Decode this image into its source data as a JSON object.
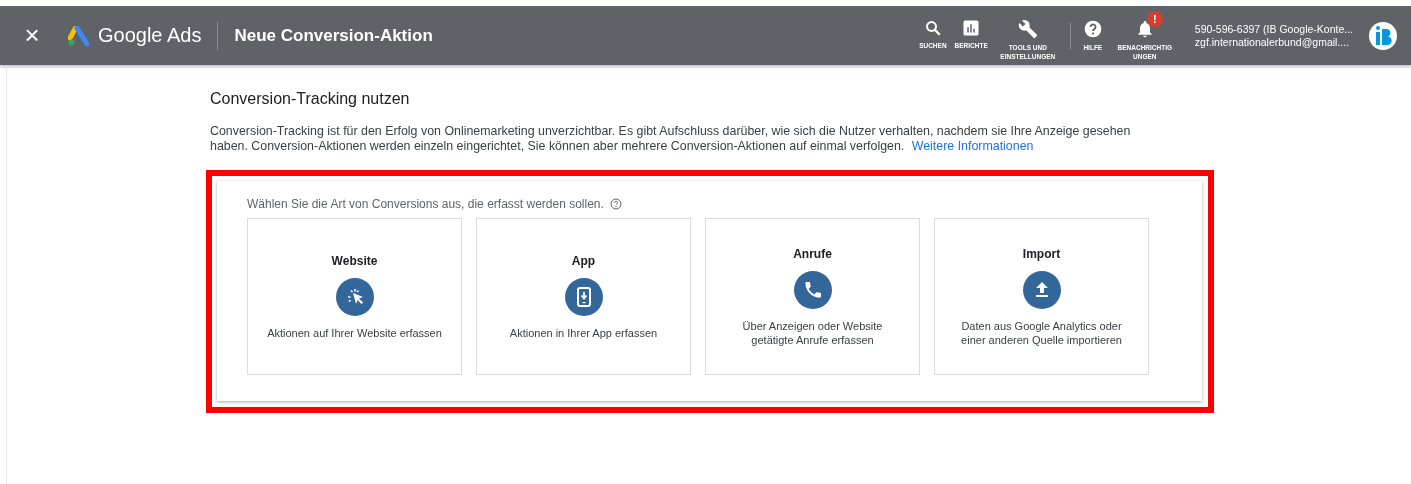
{
  "topbar": {
    "close": "×",
    "product": "Google Ads",
    "title": "Neue Conversion-Aktion",
    "tools": [
      {
        "kind": "search",
        "label": "SUCHEN"
      },
      {
        "kind": "reports",
        "label": "BERICHTE"
      },
      {
        "kind": "tools",
        "label": "TOOLS UND EINSTELLUNGEN"
      },
      {
        "kind": "help",
        "label": "HILFE"
      },
      {
        "kind": "notifications",
        "label": "BENACHRICHTIG UNGEN",
        "badge": "!"
      }
    ],
    "account": {
      "name": "590-596-6397 (IB Google-Konte...",
      "email": "zgf.internationalerbund@gmail...."
    }
  },
  "heading": "Conversion-Tracking nutzen",
  "intro": "Conversion-Tracking ist für den Erfolg von Onlinemarketing unverzichtbar. Es gibt Aufschluss darüber, wie sich die Nutzer verhalten, nachdem sie Ihre Anzeige gesehen haben. Conversion-Aktionen werden einzeln eingerichtet, Sie können aber mehrere Conversion-Aktionen auf einmal verfolgen.",
  "intro_link": "Weitere Informationen",
  "prompt": "Wählen Sie die Art von Conversions aus, die erfasst werden sollen.",
  "options": [
    {
      "kind": "website",
      "title": "Website",
      "description": "Aktionen auf Ihrer Website erfassen"
    },
    {
      "kind": "app",
      "title": "App",
      "description": "Aktionen in Ihrer App erfassen"
    },
    {
      "kind": "calls",
      "title": "Anrufe",
      "description": "Über Anzeigen oder Website getätigte Anrufe erfassen"
    },
    {
      "kind": "import",
      "title": "Import",
      "description": "Daten aus Google Analytics oder einer anderen Quelle importieren"
    }
  ]
}
